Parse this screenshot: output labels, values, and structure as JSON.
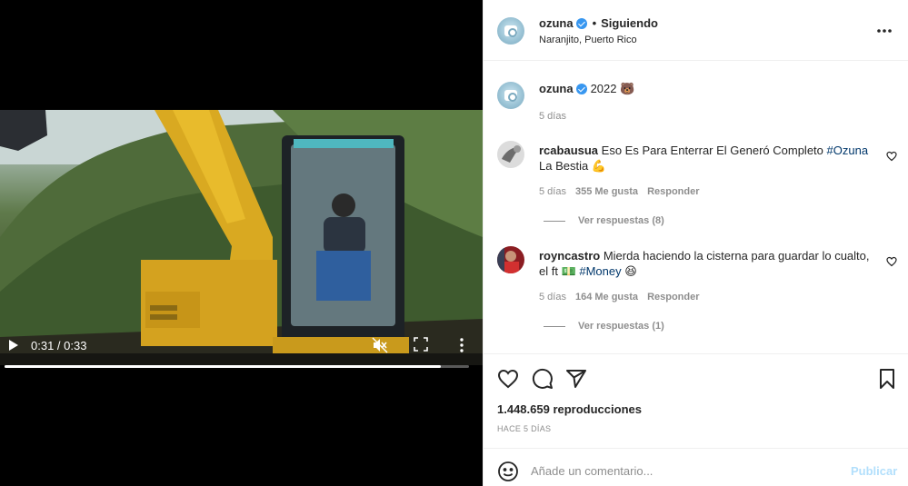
{
  "post": {
    "username": "ozuna",
    "follow_dot": "•",
    "follow_status": "Siguiendo",
    "location": "Naranjito, Puerto Rico",
    "more_icon": "more-horizontal-icon"
  },
  "caption": {
    "username": "ozuna",
    "text": "2022 🐻",
    "time": "5 días"
  },
  "comments": [
    {
      "username": "rcabausua",
      "text_before": "Eso Es Para Enterrar El Generó Completo ",
      "hashtag": "#Ozuna",
      "text_after": " La Bestia 💪",
      "time": "5 días",
      "likes": "355 Me gusta",
      "reply": "Responder",
      "view_replies": "Ver respuestas (8)"
    },
    {
      "username": "royncastro",
      "text_before": "Mierda haciendo la cisterna para guardar lo cualto, el ft 💵 ",
      "hashtag": "#Money",
      "text_after": " 😆",
      "time": "5 días",
      "likes": "164 Me gusta",
      "reply": "Responder",
      "view_replies": "Ver respuestas (1)"
    }
  ],
  "video": {
    "time_display": "0:31 / 0:33",
    "progress": 0.94,
    "muted": true
  },
  "stats": {
    "views": "1.448.659 reproducciones",
    "posted": "HACE 5 DÍAS"
  },
  "add_comment": {
    "placeholder": "Añade un comentario...",
    "publish": "Publicar"
  },
  "colors": {
    "link": "#00376b",
    "verified": "#3897f0",
    "publish_disabled": "#b2dffc",
    "meta": "#8e8e8e"
  }
}
